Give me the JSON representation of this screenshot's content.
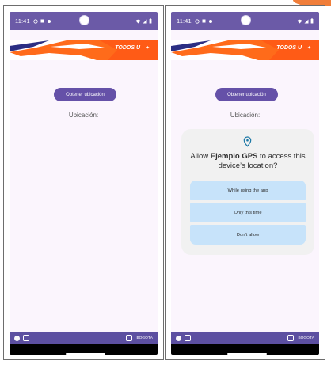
{
  "screens": [
    {
      "status_bar": {
        "time": "11:41"
      },
      "banner": {
        "brand_text": "TODOS U",
        "brand_colors": [
          "#2b2f83",
          "#ff6b1a",
          "#ffffff"
        ]
      },
      "main": {
        "button_label": "Obtener ubicación",
        "location_label": "Ubicación:"
      },
      "footer": {
        "left_marks": [
          "",
          ""
        ],
        "right_marks": [
          "",
          "BOGOTÁ"
        ]
      }
    },
    {
      "status_bar": {
        "time": "11:41"
      },
      "banner": {
        "brand_text": "TODOS U",
        "brand_colors": [
          "#2b2f83",
          "#ff6b1a",
          "#ffffff"
        ]
      },
      "main": {
        "button_label": "Obtener ubicación",
        "location_label": "Ubicación:"
      },
      "dialog": {
        "prompt_prefix": "Allow ",
        "app_name": "Ejemplo GPS",
        "prompt_suffix": " to access this device’s location?",
        "options": [
          "While using the app",
          "Only this time",
          "Don’t allow"
        ]
      },
      "footer": {
        "left_marks": [
          "",
          ""
        ],
        "right_marks": [
          "",
          "BOGOTÁ"
        ]
      }
    }
  ],
  "colors": {
    "status_bar": "#6b5aa7",
    "button": "#6551a8",
    "dialog_bg": "#f1f1f1",
    "dialog_option_bg": "#c7e3fa",
    "footer_bg": "#5c4fa1",
    "screen_bg": "#fbf5fd"
  },
  "icons": {
    "status": [
      "wifi-icon",
      "signal-icon",
      "battery-icon",
      "notification-icon"
    ],
    "dialog": "location-pin-icon"
  }
}
